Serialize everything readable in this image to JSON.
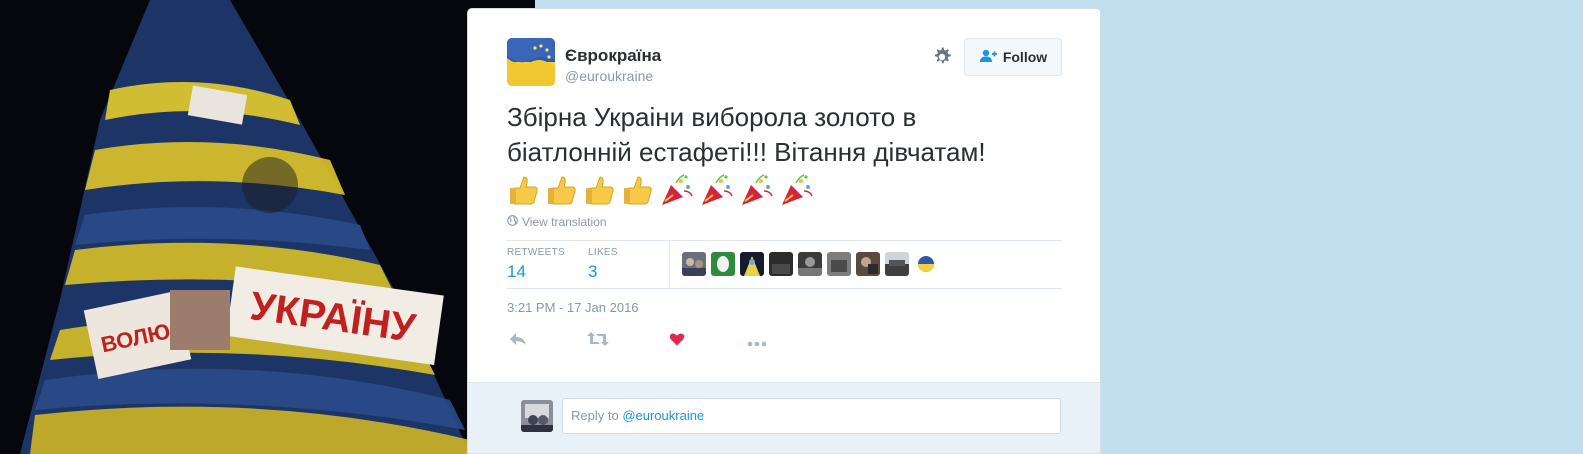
{
  "tweet": {
    "author": {
      "fullname": "Єврокраїна",
      "screenname": "@euroukraine"
    },
    "follow_label": "Follow",
    "text_line1": "Збірна Украіни виборола золото в",
    "text_line2": "біатлонній естафеті!!! Вітання дівчатам!",
    "emojis": [
      "thumbs-up-icon",
      "thumbs-up-icon",
      "thumbs-up-icon",
      "thumbs-up-icon",
      "party-popper-icon",
      "party-popper-icon",
      "party-popper-icon",
      "party-popper-icon"
    ],
    "translate_label": "View translation",
    "stats": {
      "retweets_label": "RETWEETS",
      "retweets": "14",
      "likes_label": "LIKES",
      "likes": "3"
    },
    "timestamp": "3:21 PM - 17 Jan 2016"
  },
  "reply": {
    "prefix": "Reply to ",
    "mention": "@euroukraine"
  },
  "colors": {
    "page_bg": "#c0deed",
    "link": "#1b95e0",
    "muted": "#8899a6",
    "heart": "#e2264d",
    "reply_bg": "#e8f1f8"
  }
}
